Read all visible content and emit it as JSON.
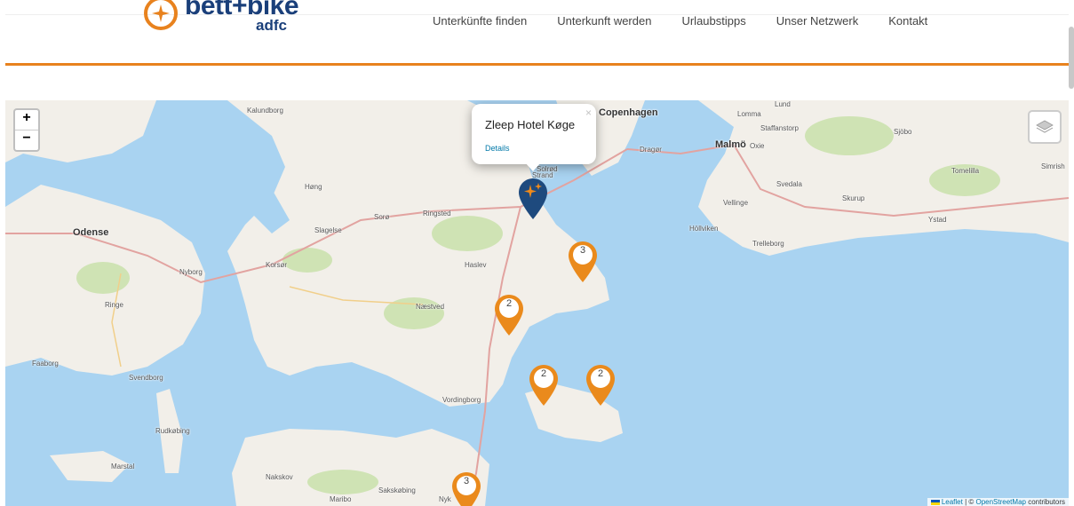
{
  "header": {
    "logo_text": "bett+bike",
    "logo_sub": "adfc",
    "nav": [
      "Unterkünfte finden",
      "Unterkunft werden",
      "Urlaubstipps",
      "Unser Netzwerk",
      "Kontakt"
    ]
  },
  "map": {
    "zoom_in": "+",
    "zoom_out": "−",
    "popup": {
      "title": "Zleep Hotel Køge",
      "link": "Details",
      "close": "×"
    },
    "clusters": [
      "3",
      "2",
      "2",
      "2",
      "3"
    ],
    "places": {
      "copenhagen": "Copenhagen",
      "kalundborg": "Kalundborg",
      "lomma": "Lomma",
      "lund": "Lund",
      "staffanstorp": "Staffanstorp",
      "sjobo": "Sjöbo",
      "malmo": "Malmö",
      "dragor": "Dragør",
      "oxie": "Oxie",
      "tomelilla": "Tomelilla",
      "simrishamn": "Simrish",
      "svedala": "Svedala",
      "vellinge": "Vellinge",
      "skurup": "Skurup",
      "ystad": "Ystad",
      "hollviken": "Höllviken",
      "trelleborg": "Trelleborg",
      "solrod": "Solrød",
      "strand": "Strand",
      "hong": "Høng",
      "soro": "Sorø",
      "ringsted": "Ringsted",
      "odense": "Odense",
      "slagelse": "Slagelse",
      "korsor": "Korsør",
      "nyborg": "Nyborg",
      "haslev": "Haslev",
      "ringe": "Ringe",
      "naestved": "Næstved",
      "faaborg": "Faaborg",
      "svendborg": "Svendborg",
      "vordingborg": "Vordingborg",
      "rudkobing": "Rudkøbing",
      "marstal": "Marstal",
      "nakskov": "Nakskov",
      "sakskobing": "Sakskøbing",
      "maribo": "Maribo",
      "nyk": "Nyk"
    },
    "attribution": {
      "leaflet": "Leaflet",
      "sep": " | © ",
      "osm": "OpenStreetMap",
      "contrib": " contributors"
    },
    "colors": {
      "water": "#a9d3f1",
      "land": "#f2efe9",
      "forest": "#cfe3b4",
      "marker_orange": "#ea8a1c",
      "marker_blue": "#1e4a7e",
      "accent": "#e8821e"
    }
  }
}
